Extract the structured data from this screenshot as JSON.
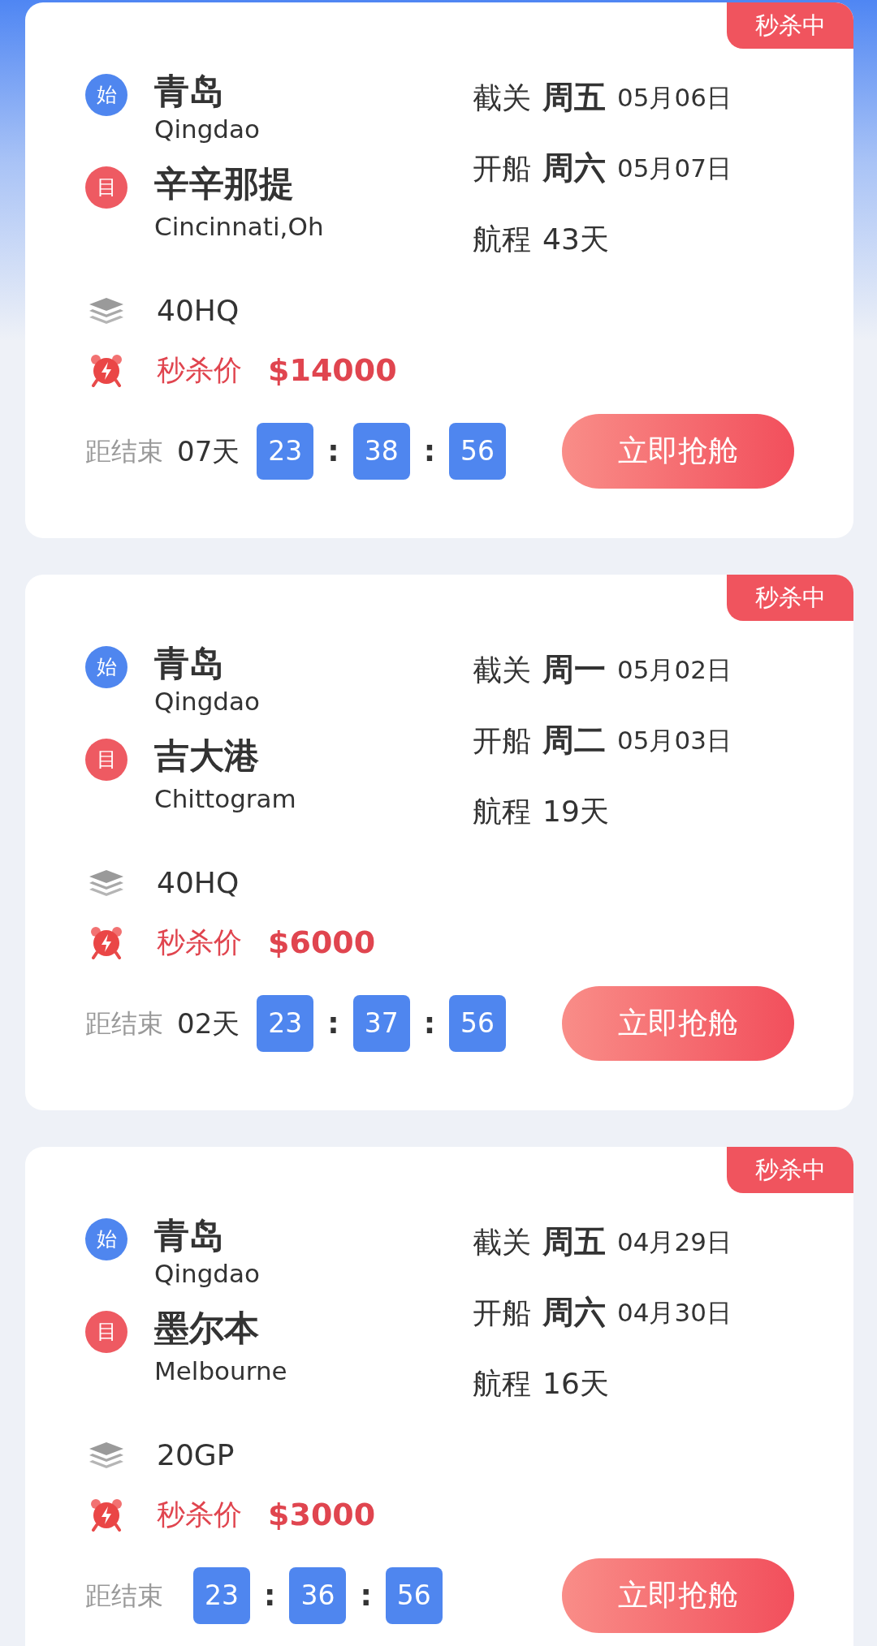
{
  "cards": [
    {
      "badge": "秒杀中",
      "origin": {
        "marker": "始",
        "name": "青岛",
        "name_en": "Qingdao"
      },
      "destination": {
        "marker": "目",
        "name": "辛辛那提",
        "name_en": "Cincinnati,Oh"
      },
      "schedule": [
        {
          "kind": "date",
          "label": "截关",
          "weekday": "周五",
          "date": "05月06日"
        },
        {
          "kind": "date",
          "label": "开船",
          "weekday": "周六",
          "date": "05月07日"
        },
        {
          "kind": "duration",
          "label": "航程",
          "value": "43天"
        }
      ],
      "container": "40HQ",
      "price_label": "秒杀价",
      "price": "$14000",
      "countdown": {
        "label": "距结束",
        "days": "07天",
        "hours": "23",
        "minutes": "38",
        "seconds": "56",
        "separator": ":"
      },
      "button": "立即抢舱"
    },
    {
      "badge": "秒杀中",
      "origin": {
        "marker": "始",
        "name": "青岛",
        "name_en": "Qingdao"
      },
      "destination": {
        "marker": "目",
        "name": "吉大港",
        "name_en": "Chittogram"
      },
      "schedule": [
        {
          "kind": "date",
          "label": "截关",
          "weekday": "周一",
          "date": "05月02日"
        },
        {
          "kind": "date",
          "label": "开船",
          "weekday": "周二",
          "date": "05月03日"
        },
        {
          "kind": "duration",
          "label": "航程",
          "value": "19天"
        }
      ],
      "container": "40HQ",
      "price_label": "秒杀价",
      "price": "$6000",
      "countdown": {
        "label": "距结束",
        "days": "02天",
        "hours": "23",
        "minutes": "37",
        "seconds": "56",
        "separator": ":"
      },
      "button": "立即抢舱"
    },
    {
      "badge": "秒杀中",
      "origin": {
        "marker": "始",
        "name": "青岛",
        "name_en": "Qingdao"
      },
      "destination": {
        "marker": "目",
        "name": "墨尔本",
        "name_en": "Melbourne"
      },
      "schedule": [
        {
          "kind": "date",
          "label": "截关",
          "weekday": "周五",
          "date": "04月29日"
        },
        {
          "kind": "date",
          "label": "开船",
          "weekday": "周六",
          "date": "04月30日"
        },
        {
          "kind": "duration",
          "label": "航程",
          "value": "16天"
        }
      ],
      "container": "20GP",
      "price_label": "秒杀价",
      "price": "$3000",
      "countdown": {
        "label": "距结束",
        "hours": "23",
        "minutes": "36",
        "seconds": "56",
        "separator": ":"
      },
      "button": "立即抢舱"
    }
  ]
}
